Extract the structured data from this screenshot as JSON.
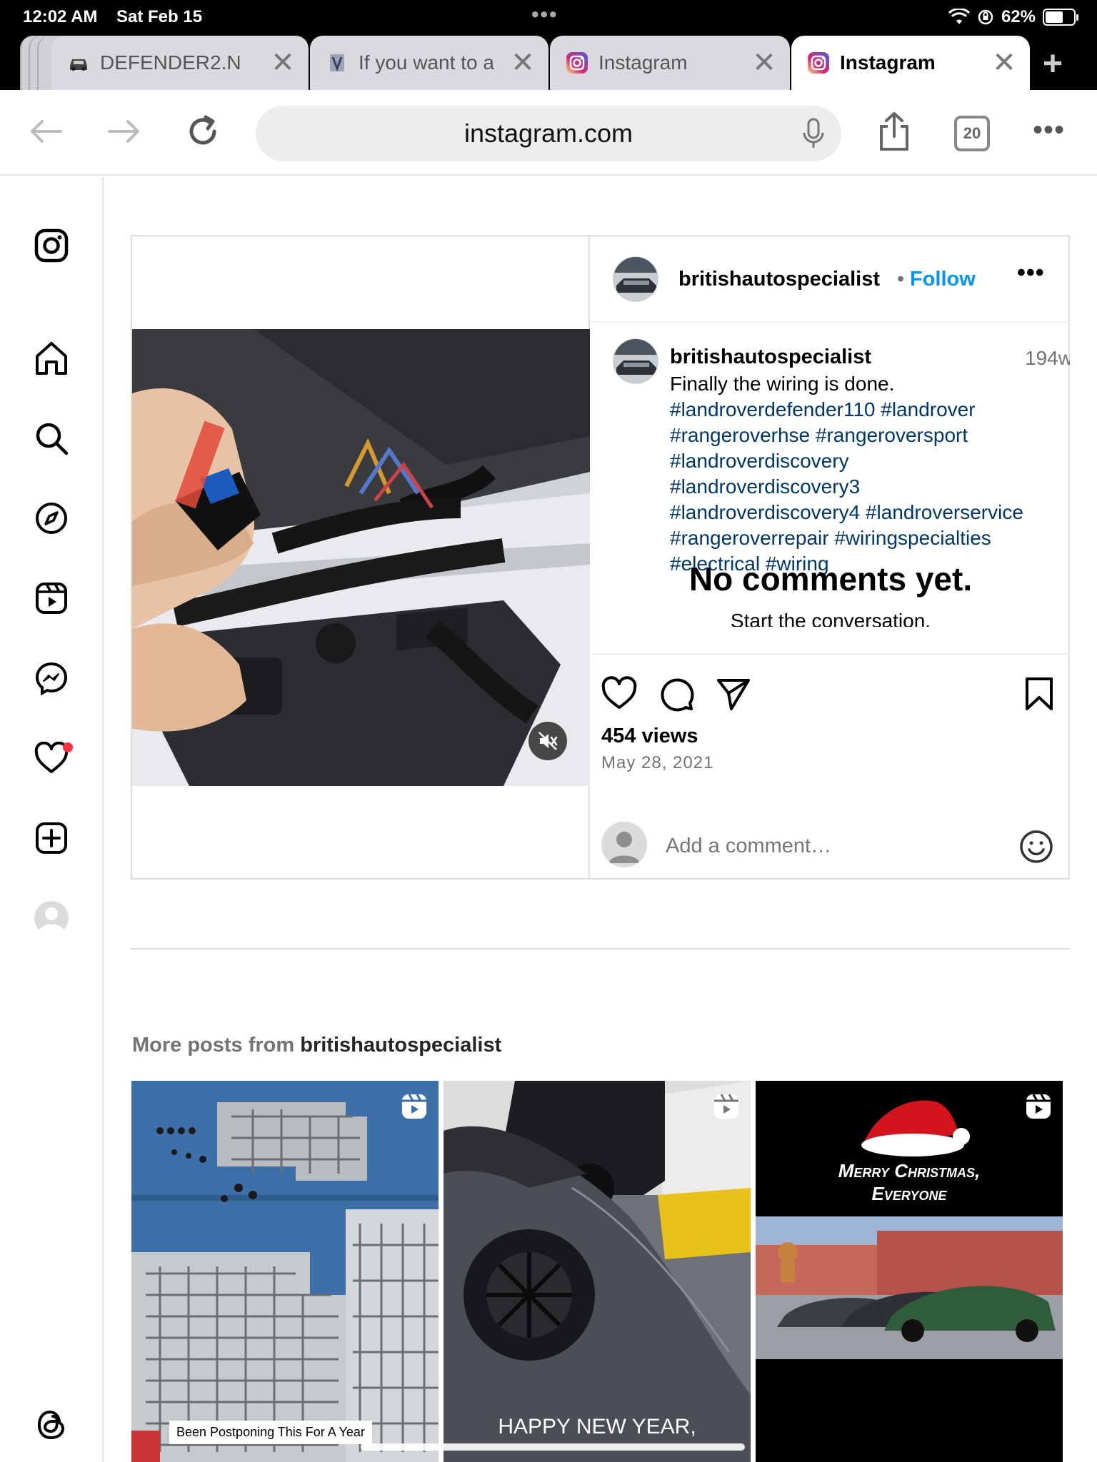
{
  "status_bar": {
    "time": "12:02 AM",
    "date": "Sat Feb 15",
    "battery": "62%",
    "battery_level": 0.62
  },
  "tabs": [
    {
      "title": "DEFENDER2.N",
      "icon": "car-icon",
      "active": false
    },
    {
      "title": "If you want to a",
      "icon": "page-icon",
      "active": false
    },
    {
      "title": "Instagram",
      "icon": "instagram-icon",
      "active": false
    },
    {
      "title": "Instagram",
      "icon": "instagram-icon",
      "active": true
    }
  ],
  "toolbar": {
    "url": "instagram.com",
    "tab_count": "20"
  },
  "nav": {
    "items": [
      "instagram-logo-icon",
      "home-icon",
      "search-icon",
      "explore-icon",
      "reels-icon",
      "messenger-icon",
      "notifications-icon",
      "create-icon",
      "profile-icon",
      "threads-icon"
    ]
  },
  "post": {
    "username": "britishautospecialist",
    "separator": "•",
    "follow_label": "Follow",
    "more_label": "•••",
    "caption_user": "britishautospecialist",
    "age": "194w",
    "caption_text": "Finally the wiring is done.",
    "hashtags": "#landroverdefender110 #landrover #rangeroverhse #rangeroversport #landroverdiscovery #landroverdiscovery3 #landroverdiscovery4 #landroverservice #rangeroverrepair #wiringspecialties #electrical #wiring",
    "no_comments": "No comments yet.",
    "start_conversation": "Start the conversation.",
    "views": "454 views",
    "date": "May 28, 2021",
    "comment_placeholder": "Add a comment…"
  },
  "more_posts": {
    "prefix": "More posts from",
    "username": "britishautospecialist",
    "thumbs": [
      {
        "caption": "Been Postponing This For A Year"
      },
      {
        "caption": "HAPPY NEW YEAR,"
      },
      {
        "caption_line1": "Merry Christmas,",
        "caption_line2": "Everyone"
      }
    ]
  },
  "colors": {
    "accent": "#0095f6",
    "hashtag": "#00376b",
    "notification_dot": "#ff3040"
  }
}
